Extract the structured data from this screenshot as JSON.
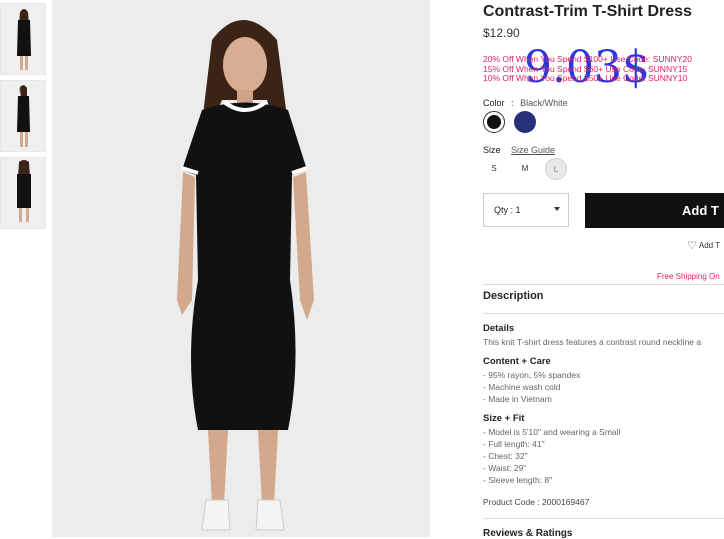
{
  "product": {
    "title": "Contrast-Trim T-Shirt Dress",
    "price": "$12.90",
    "overlay_price": "9.03$",
    "promos": [
      "20% Off When You Spend $100+ Use Code: SUNNY20",
      "15% Off When You Spend $60+ Use Code: SUNNY15",
      "10% Off When You Spend $50+ Use Code: SUNNY10"
    ]
  },
  "color": {
    "label": "Color",
    "separator": ":",
    "selected": "Black/White",
    "swatches": [
      {
        "name": "Black/White",
        "hex": "#111111"
      },
      {
        "name": "Navy",
        "hex": "#283178"
      }
    ]
  },
  "size": {
    "label": "Size",
    "guide": "Size Guide",
    "options": [
      "S",
      "M",
      "L"
    ],
    "unavailable": [
      "L"
    ]
  },
  "quantity": {
    "label": "Qty : 1"
  },
  "actions": {
    "add_to_bag": "Add T",
    "add_to_wishlist": "Add T",
    "free_shipping": "Free Shipping On"
  },
  "description": {
    "heading": "Description",
    "details_heading": "Details",
    "details_text": "This knit T-shirt dress features a contrast round neckline a",
    "care_heading": "Content + Care",
    "care_items": [
      "- 95% rayon, 5% spandex",
      "- Machine wash cold",
      "- Made in Vietnam"
    ],
    "fit_heading": "Size + Fit",
    "fit_items": [
      "- Model is 5'10\" and wearing a Small",
      "- Full length: 41\"",
      "- Chest: 32\"",
      "- Waist: 29\"",
      "- Sleeve length: 8\""
    ],
    "product_code": "Product Code : 2000169467"
  },
  "reviews": {
    "heading": "Reviews & Ratings"
  },
  "colors": {
    "promo": "#e0245e",
    "overlay": "#2b35e0",
    "button": "#111111"
  }
}
